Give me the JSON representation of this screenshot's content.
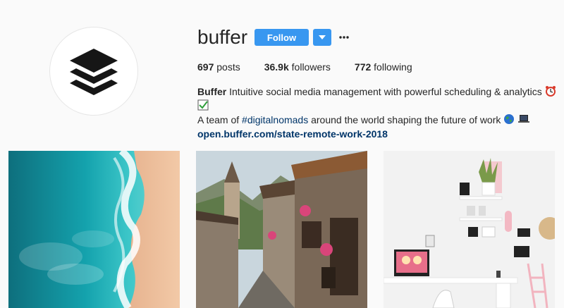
{
  "profile": {
    "username": "buffer",
    "follow_label": "Follow",
    "stats": {
      "posts_count": "697",
      "posts_label": "posts",
      "followers_count": "36.9k",
      "followers_label": "followers",
      "following_count": "772",
      "following_label": "following"
    },
    "bio": {
      "name": "Buffer",
      "line1": "Intuitive social media management with powerful scheduling & analytics",
      "line2_prefix": "A team of",
      "hashtag": "#digitalnomads",
      "line2_suffix": "around the world shaping the future of work",
      "link": "open.buffer.com/state-remote-work-2018"
    }
  },
  "icons": {
    "avatar": "buffer-logo-icon",
    "dropdown": "chevron-down-icon",
    "more": "more-options-icon",
    "emoji_1": "alarm-clock-icon",
    "emoji_2": "check-box-icon",
    "emoji_3": "globe-icon",
    "emoji_4": "laptop-icon"
  },
  "posts": [
    {
      "subject": "aerial beach and ocean"
    },
    {
      "subject": "mountain village street"
    },
    {
      "subject": "white desk workspace"
    }
  ],
  "colors": {
    "accent": "#3897f0",
    "link": "#003569",
    "background": "#fafafa"
  }
}
